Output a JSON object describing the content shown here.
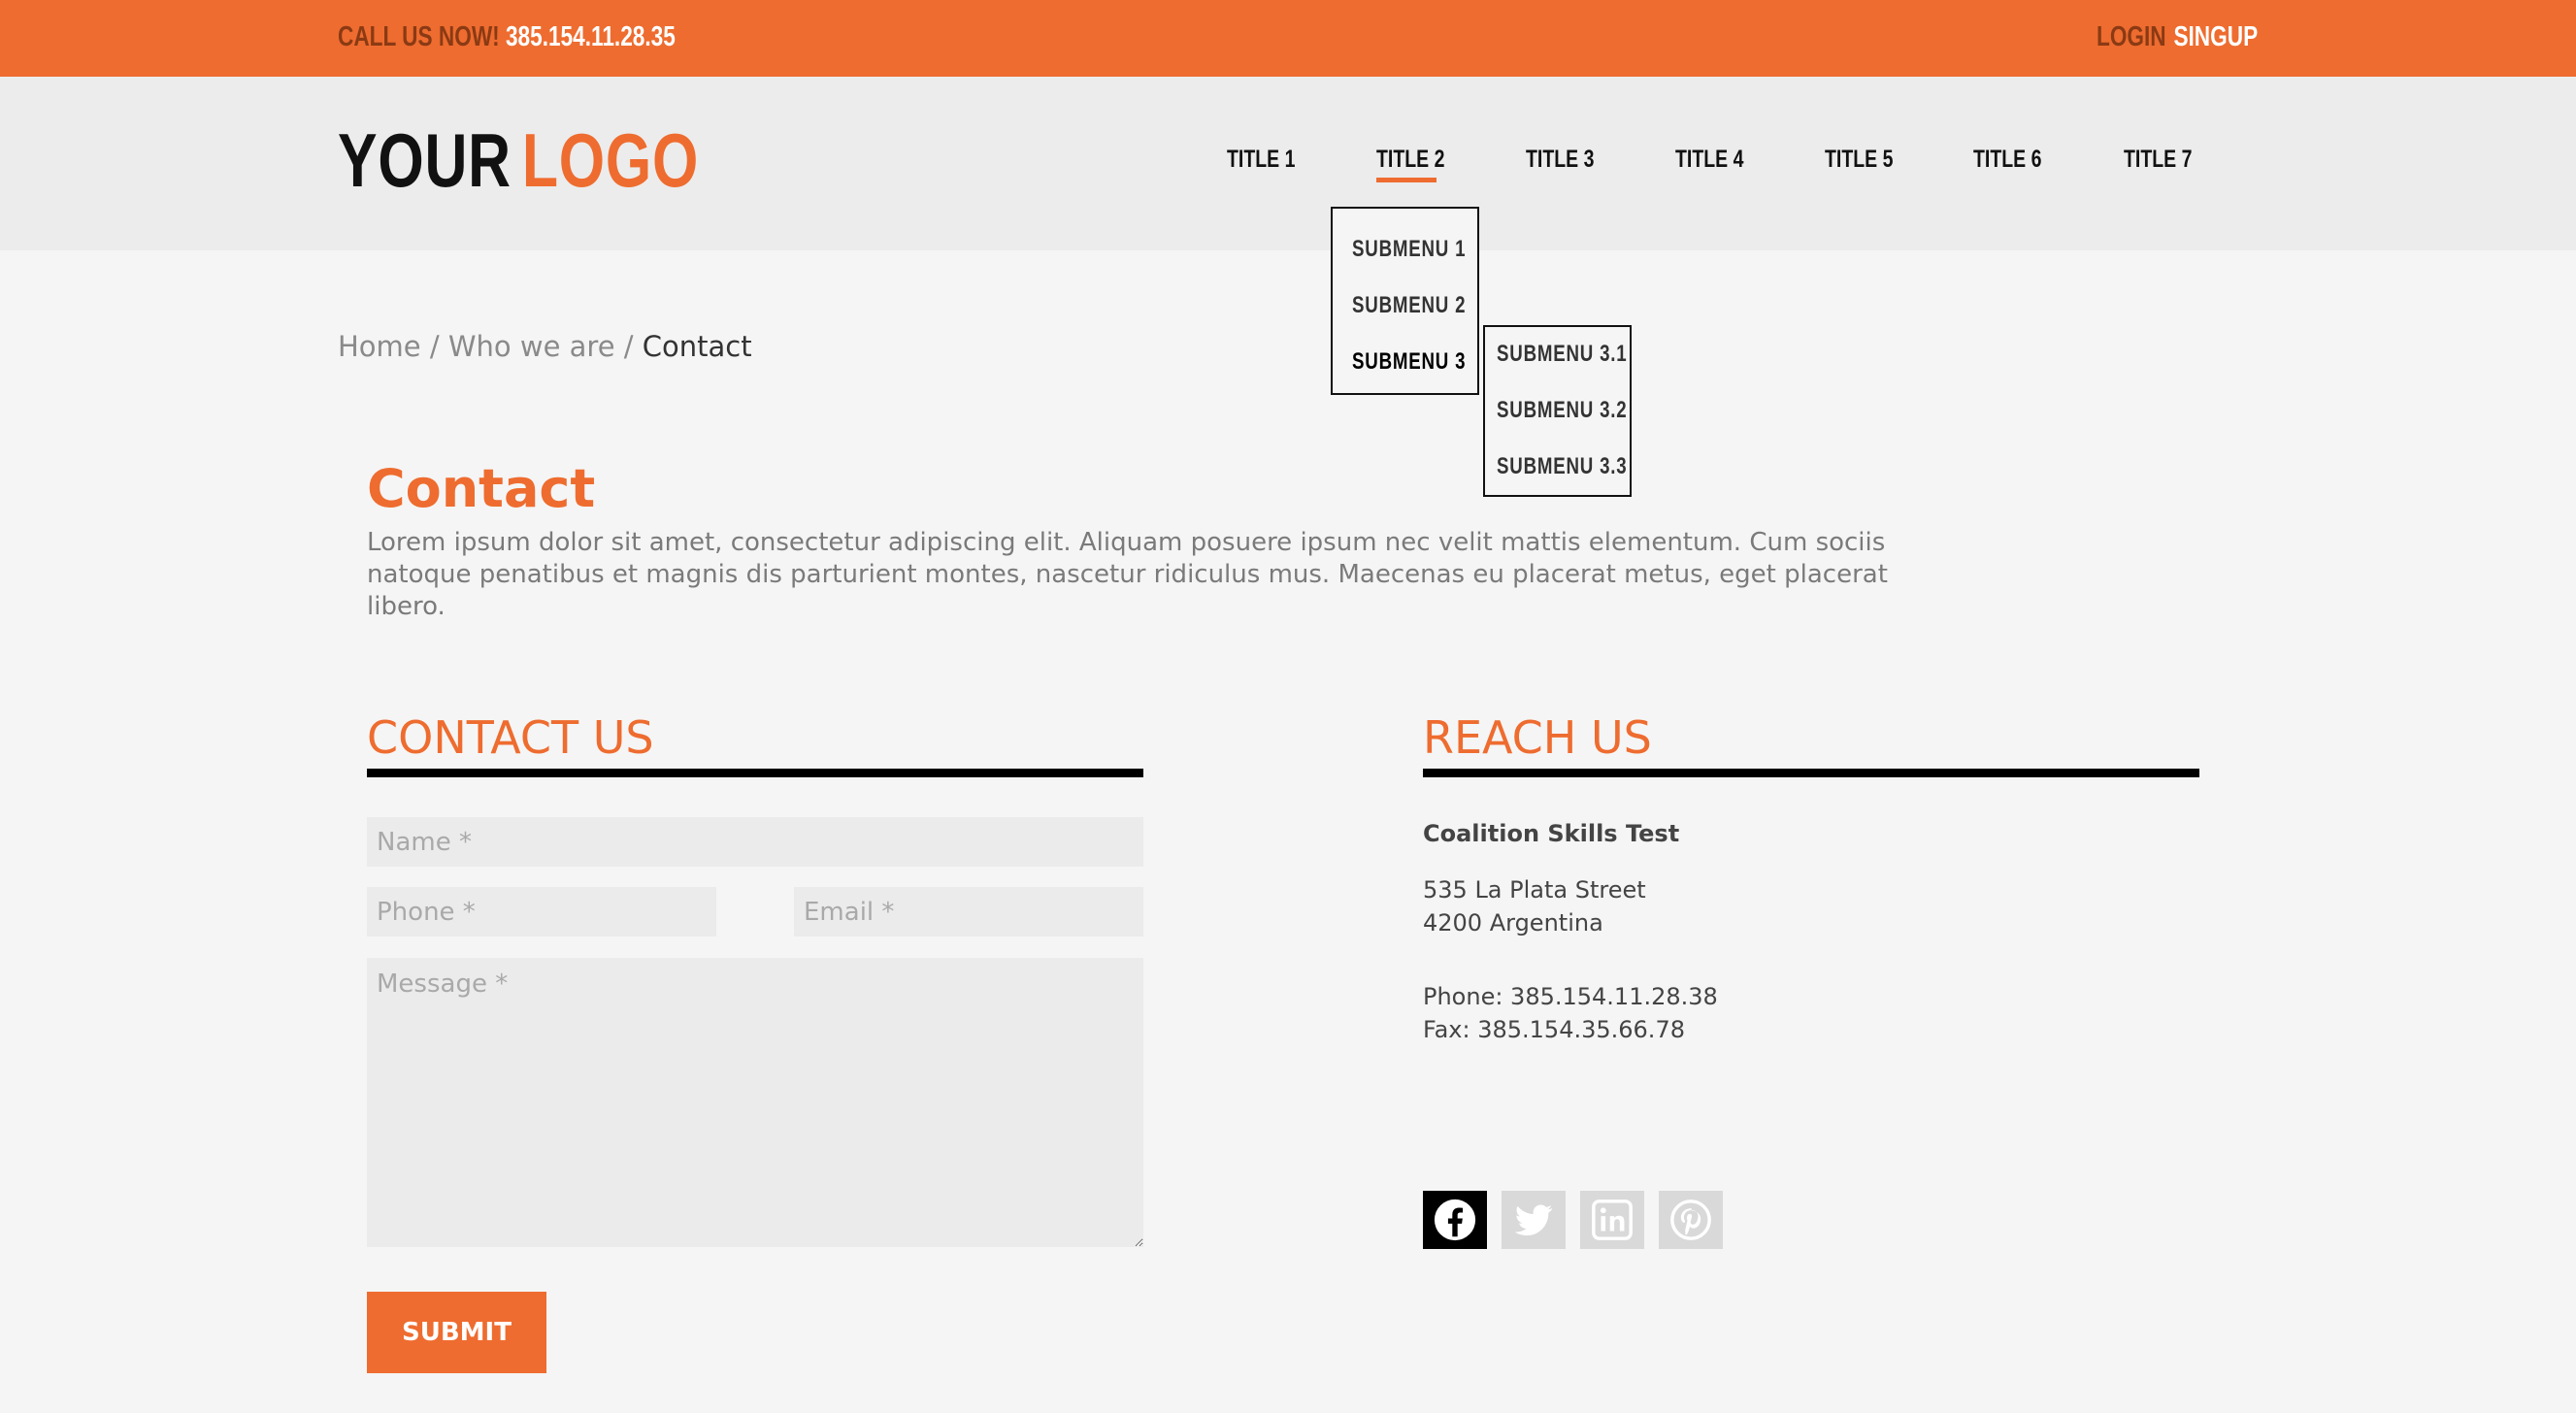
{
  "topbar": {
    "call_label": "CALL US NOW!",
    "phone": "385.154.11.28.35",
    "login": "LOGIN",
    "signup": "SINGUP"
  },
  "logo": {
    "part1": "YOUR",
    "part2": "LOGO"
  },
  "nav": {
    "items": [
      "TITLE 1",
      "TITLE 2",
      "TITLE 3",
      "TITLE 4",
      "TITLE 5",
      "TITLE 6",
      "TITLE 7"
    ],
    "active": "TITLE 2"
  },
  "submenu": [
    "SUBMENU 1",
    "SUBMENU 2",
    "SUBMENU 3"
  ],
  "submenu3": [
    "SUBMENU 3.1",
    "SUBMENU 3.2",
    "SUBMENU 3.3"
  ],
  "breadcrumb": {
    "home": "Home",
    "sep1": " / ",
    "who": "Who we are",
    "sep2": " / ",
    "current": "Contact"
  },
  "page": {
    "title": "Contact",
    "intro": "Lorem ipsum dolor sit amet, consectetur adipiscing elit. Aliquam posuere ipsum nec velit mattis elementum. Cum sociis natoque penatibus et magnis dis parturient montes, nascetur ridiculus mus. Maecenas eu placerat metus, eget placerat libero."
  },
  "contact_form": {
    "title": "CONTACT US",
    "name_placeholder": "Name *",
    "phone_placeholder": "Phone *",
    "email_placeholder": "Email *",
    "message_placeholder": "Message *",
    "submit": "SUBMIT"
  },
  "reach": {
    "title": "REACH US",
    "company": "Coalition Skills Test",
    "street": "535 La Plata Street",
    "city": "4200 Argentina",
    "phone": "Phone: 385.154.11.28.38",
    "fax": "Fax: 385.154.35.66.78"
  },
  "social": [
    "facebook-icon",
    "twitter-icon",
    "linkedin-icon",
    "pinterest-icon"
  ],
  "colors": {
    "accent": "#ee6c2f",
    "dark": "#111111",
    "background": "#f5f5f5"
  }
}
